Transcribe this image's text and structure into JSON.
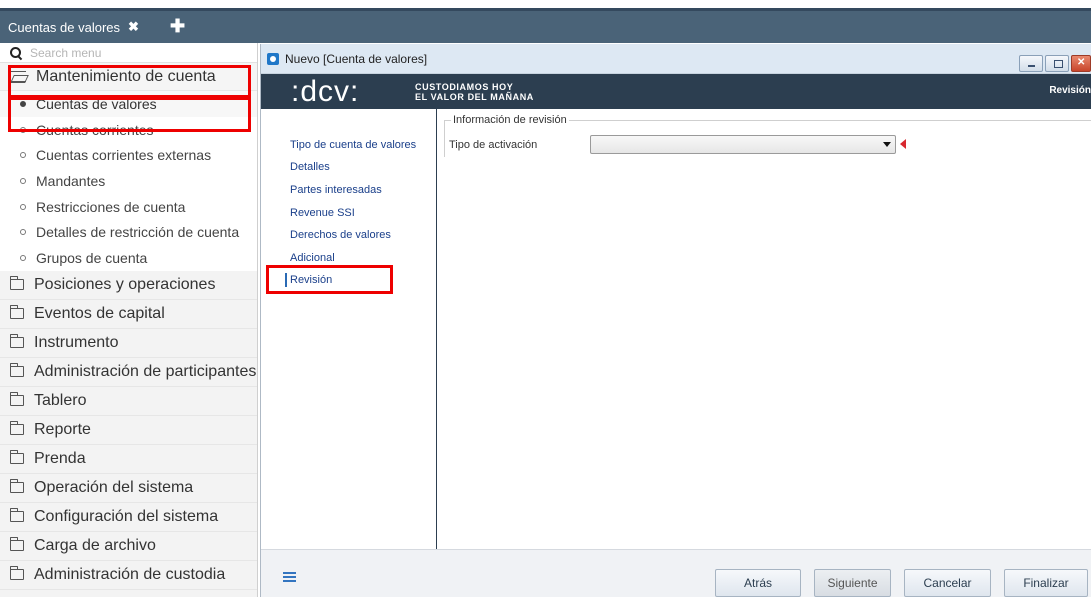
{
  "tab_bar": {
    "tab_label": "Cuentas de valores",
    "close_glyph": "✖",
    "add_glyph": "✚"
  },
  "sidebar": {
    "search_placeholder": "Search menu",
    "open_group": "Mantenimiento de cuenta",
    "sub_items": [
      "Cuentas de valores",
      "Cuentas corrientes",
      "Cuentas corrientes externas",
      "Mandantes",
      "Restricciones de cuenta",
      "Detalles de restricción de cuenta",
      "Grupos de cuenta"
    ],
    "groups": [
      "Posiciones y operaciones",
      "Eventos de capital",
      "Instrumento",
      "Administración de participantes",
      "Tablero",
      "Reporte",
      "Prenda",
      "Operación del sistema",
      "Configuración del sistema",
      "Carga de archivo",
      "Administración de custodia"
    ]
  },
  "window": {
    "title": "Nuevo [Cuenta de valores]",
    "brand_logo": ":dcv:",
    "brand_tagline_1": "CUSTODIAMOS HOY",
    "brand_tagline_2": "EL VALOR DEL MAÑANA",
    "brand_section": "Revisión"
  },
  "steps": [
    "Tipo de cuenta de valores",
    "Detalles",
    "Partes interesadas",
    "Revenue SSI",
    "Derechos de valores",
    "Adicional",
    "Revisión"
  ],
  "form": {
    "legend": "Información de revisión",
    "field_label": "Tipo de activación",
    "field_value": ""
  },
  "footer": {
    "back": "Atrás",
    "next": "Siguiente",
    "cancel": "Cancelar",
    "finish": "Finalizar"
  },
  "colors": {
    "tab_bar": "#4a6378",
    "brand_bar": "#2c3e50",
    "highlight": "#ee0000",
    "link": "#1a3f8a",
    "required": "#d7282f"
  }
}
